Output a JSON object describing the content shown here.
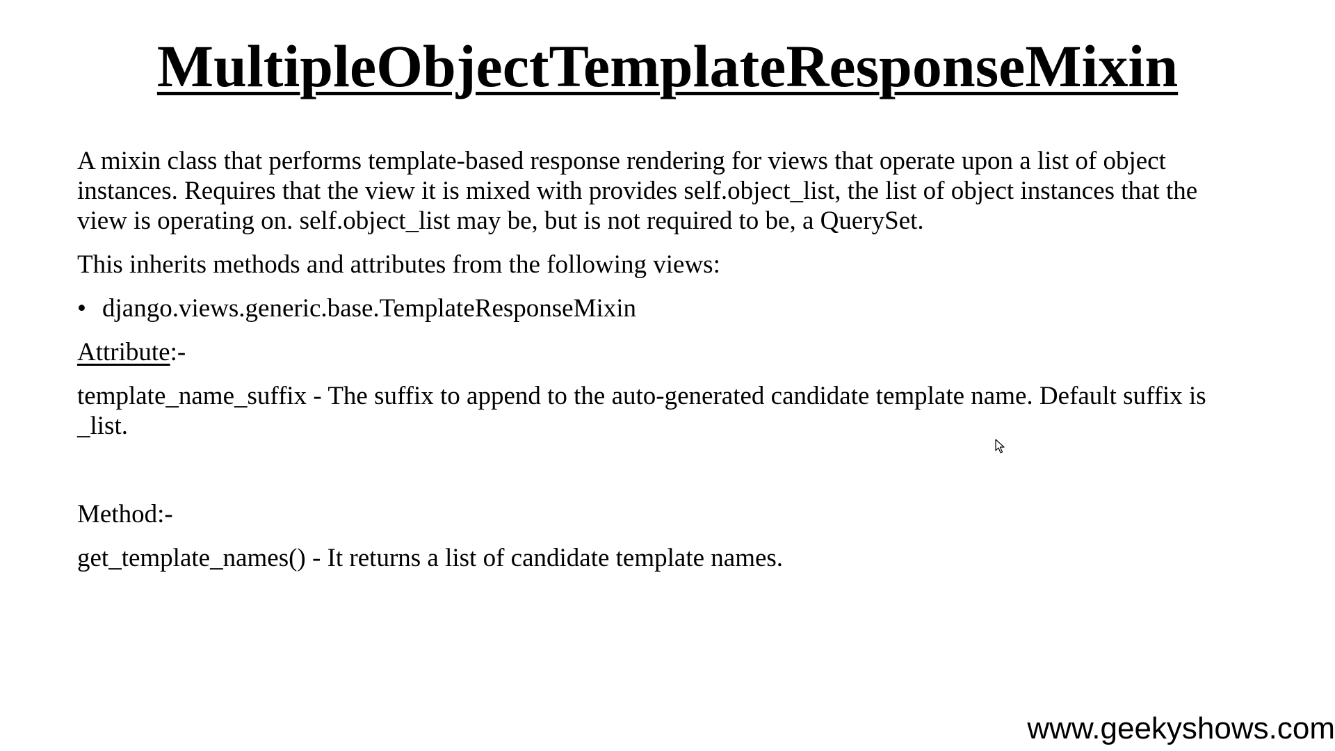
{
  "slide": {
    "title": "MultipleObjectTemplateResponseMixin",
    "description": "A mixin class that performs template-based response rendering for views that operate upon a list of object instances. Requires that the view it is mixed with provides self.object_list, the list of object instances that the view is operating on. self.object_list may be, but is not required to be, a QuerySet.",
    "inherits_intro": "This inherits methods and attributes from the following views:",
    "inherits_list": [
      {
        "bullet": "•",
        "text": "django.views.generic.base.TemplateResponseMixin"
      }
    ],
    "attribute_heading": "Attribute",
    "attribute_heading_suffix": ":-",
    "attribute_text": "template_name_suffix - The suffix to append to the auto-generated candidate template name. Default suffix is _list.",
    "method_heading": "Method",
    "method_heading_suffix": ":-",
    "method_text": "get_template_names() - It returns a list of candidate template names."
  },
  "watermark": "www.geekyshows.com",
  "icons": {
    "cursor": "mouse-pointer-icon"
  }
}
